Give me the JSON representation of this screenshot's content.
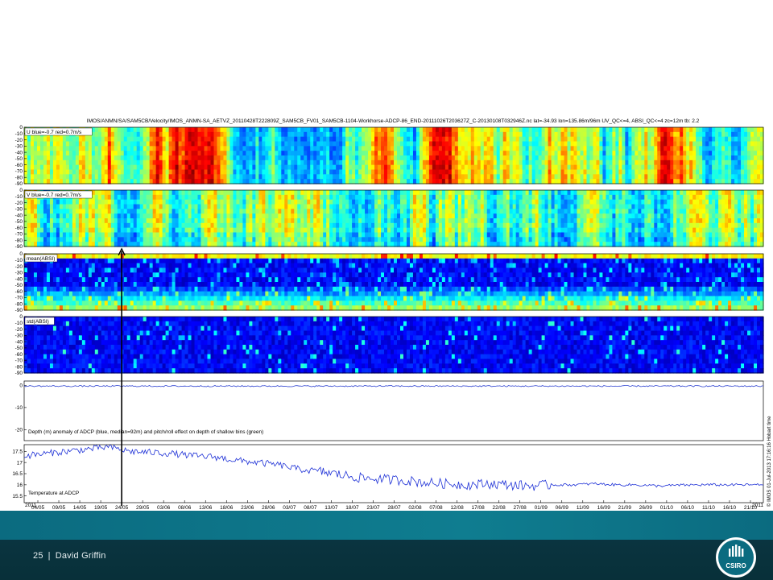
{
  "footer": {
    "page_number": "25",
    "separator": "|",
    "author": "David Griffin"
  },
  "logo": {
    "label": "CSIRO"
  },
  "chart_data": {
    "type": "heatmap",
    "title": "IMOS/ANMN/SA/SAM5CB/Velocity/IMOS_ANMN-SA_AETVZ_20110428T222809Z_SAM5CB_FV01_SAM5CB-1104-Workhorse-ADCP-86_END-20111026T203627Z_C-20130108T032946Z.nc lat=-34.93 lon=135.86m/96m UV_QC<=4, ABSI_QC<=4 zc=12m tb: 2.2",
    "side_note": "© IMOS 01-Jul-2013 17:16:16 Hobart time",
    "x_ticks": [
      "04/05",
      "09/05",
      "14/05",
      "19/05",
      "24/05",
      "29/05",
      "03/06",
      "08/06",
      "13/06",
      "18/06",
      "23/06",
      "28/06",
      "03/07",
      "08/07",
      "13/07",
      "18/07",
      "23/07",
      "28/07",
      "02/08",
      "07/08",
      "12/08",
      "17/08",
      "22/08",
      "27/08",
      "01/09",
      "06/09",
      "11/09",
      "16/09",
      "21/09",
      "26/09",
      "01/10",
      "06/10",
      "11/10",
      "16/10",
      "21/10"
    ],
    "x_year_start": "2011",
    "x_year_end": "2011",
    "panels": [
      {
        "name": "U blue=-0.7 red=0.7m/s",
        "kind": "heatmap",
        "colormap": "jet",
        "y_ticks": [
          "0",
          "-10",
          "-20",
          "-30",
          "-40",
          "-50",
          "-60",
          "-70",
          "-80",
          "-90"
        ],
        "ylim": [
          -90,
          0
        ]
      },
      {
        "name": "V blue=-0.7 red=0.7m/s",
        "kind": "heatmap",
        "colormap": "jet",
        "y_ticks": [
          "0",
          "-10",
          "-20",
          "-30",
          "-40",
          "-50",
          "-60",
          "-70",
          "-80",
          "-90"
        ],
        "ylim": [
          -90,
          0
        ]
      },
      {
        "name": "mean(ABSI)",
        "kind": "heatmap",
        "colormap": "jet",
        "y_ticks": [
          "0",
          "-10",
          "-20",
          "-30",
          "-40",
          "-50",
          "-60",
          "-70",
          "-80",
          "-90"
        ],
        "ylim": [
          -90,
          0
        ]
      },
      {
        "name": "std(ABSI)",
        "kind": "heatmap",
        "colormap": "jet",
        "y_ticks": [
          "0",
          "-10",
          "-20",
          "-30",
          "-40",
          "-50",
          "-60",
          "-70",
          "-80",
          "-90"
        ],
        "ylim": [
          -90,
          0
        ]
      },
      {
        "name": "Depth (m) anomaly of ADCP (blue, median=92m) and pitch/roll effect on depth of shallow bins (green)",
        "kind": "line",
        "y_ticks": [
          "0",
          "-10",
          "-20"
        ],
        "ylim": [
          -25,
          2
        ],
        "series_color": "#2a3fd0",
        "approx_value": -0.3
      },
      {
        "name": "Temperature at ADCP",
        "kind": "line",
        "y_ticks": [
          "17.5",
          "17",
          "16.5",
          "16",
          "15.5"
        ],
        "ylim": [
          15.2,
          17.8
        ],
        "series_color": "#1c2fd6",
        "trend": [
          [
            0,
            17.3
          ],
          [
            2,
            17.4
          ],
          [
            4,
            17.5
          ],
          [
            6,
            17.6
          ],
          [
            8,
            17.7
          ],
          [
            10,
            17.5
          ],
          [
            12,
            17.45
          ],
          [
            14,
            17.4
          ],
          [
            16,
            17.3
          ],
          [
            18,
            17.25
          ],
          [
            20,
            17.1
          ],
          [
            22,
            17.0
          ],
          [
            24,
            16.9
          ],
          [
            26,
            16.7
          ],
          [
            28,
            16.6
          ],
          [
            30,
            16.45
          ],
          [
            32,
            16.3
          ],
          [
            34,
            16.25
          ],
          [
            36,
            16.2
          ],
          [
            38,
            16.1
          ],
          [
            40,
            16.05
          ],
          [
            42,
            16.0
          ],
          [
            44,
            16.05
          ],
          [
            46,
            16.0
          ],
          [
            48,
            15.95
          ],
          [
            50,
            16.0
          ],
          [
            52,
            16.0
          ],
          [
            54,
            16.05
          ],
          [
            56,
            16.0
          ],
          [
            58,
            16.0
          ],
          [
            60,
            15.95
          ],
          [
            62,
            15.98
          ],
          [
            64,
            16.0
          ],
          [
            66,
            16.0
          ],
          [
            68,
            16.0
          ],
          [
            70,
            16.0
          ]
        ]
      }
    ],
    "marker": {
      "date": "24/05",
      "description": "arrow"
    }
  }
}
